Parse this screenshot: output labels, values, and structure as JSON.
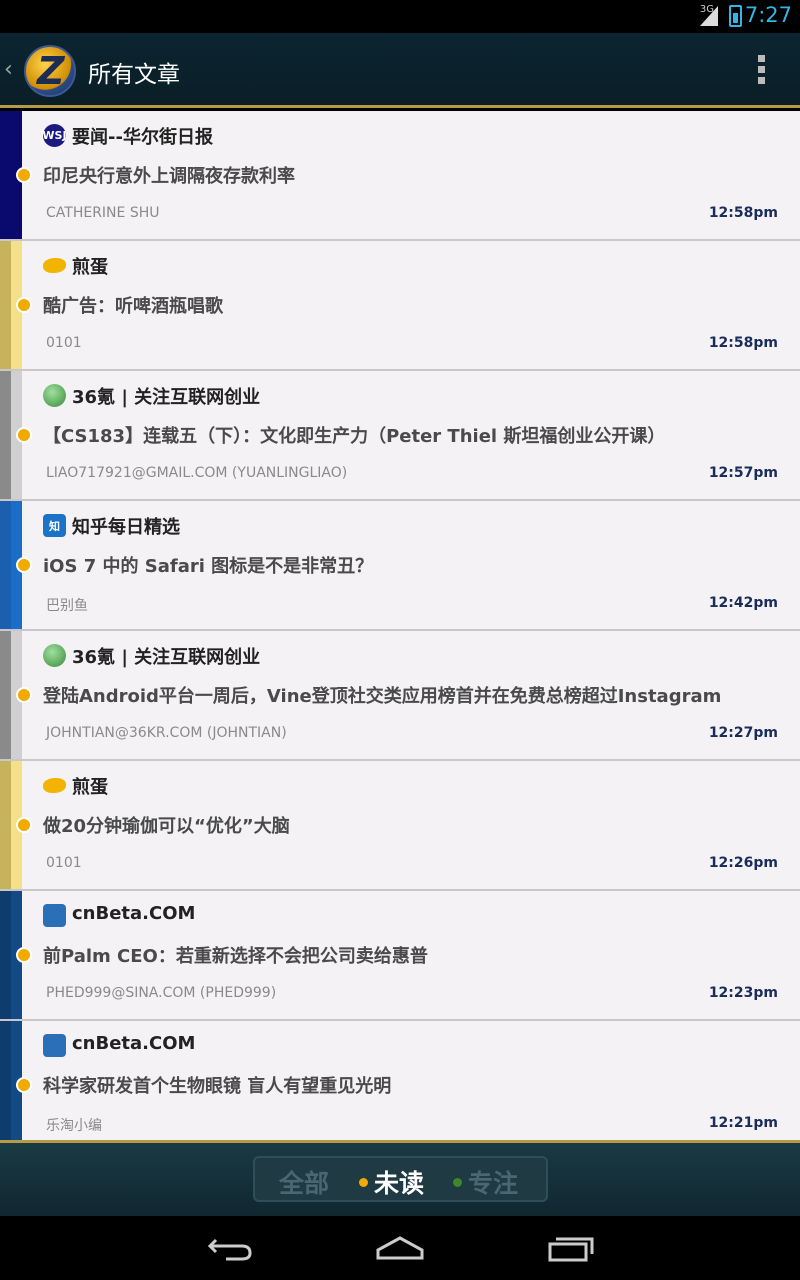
{
  "status_bar": {
    "network": "3G",
    "time": "7:27"
  },
  "action_bar": {
    "title": "所有文章"
  },
  "articles": [
    {
      "source": "要闻--华尔街日报",
      "source_icon": "WSJ",
      "title": "印尼央行意外上调隔夜存款利率",
      "author": "CATHERINE SHU",
      "time": "12:58pm",
      "color_dark": "#0a0a6e",
      "color_light": "#0a0a6e",
      "icon_bg": "#1a1a80"
    },
    {
      "source": "煎蛋",
      "source_icon": "",
      "title": "酷广告：听啤酒瓶唱歌",
      "author": "0101",
      "time": "12:58pm",
      "color_dark": "#c6b45c",
      "color_light": "#f5e08a",
      "icon_bg": "#f2b400"
    },
    {
      "source": "36氪 | 关注互联网创业",
      "source_icon": "",
      "title": "【CS183】连载五（下）：文化即生产力（Peter Thiel 斯坦福创业公开课）",
      "author": "LIAO717921@GMAIL.COM (YUANLINGLIAO)",
      "time": "12:57pm",
      "color_dark": "#8a8a8a",
      "color_light": "#d0d0d0",
      "icon_bg": "#4aa04a"
    },
    {
      "source": "知乎每日精选",
      "source_icon": "知",
      "title": "iOS 7 中的 Safari 图标是不是非常丑？",
      "author": "巴别鱼",
      "time": "12:42pm",
      "color_dark": "#1a5fb0",
      "color_light": "#1a6ec8",
      "icon_bg": "#1a73c8"
    },
    {
      "source": "36氪 | 关注互联网创业",
      "source_icon": "",
      "title": "登陆Android平台一周后，Vine登顶社交类应用榜首并在免费总榜超过Instagram",
      "author": "JOHNTIAN@36KR.COM (JOHNTIAN)",
      "time": "12:27pm",
      "color_dark": "#8a8a8a",
      "color_light": "#d0d0d0",
      "icon_bg": "#4aa04a"
    },
    {
      "source": "煎蛋",
      "source_icon": "",
      "title": "做20分钟瑜伽可以“优化”大脑",
      "author": "0101",
      "time": "12:26pm",
      "color_dark": "#c6b45c",
      "color_light": "#f5e08a",
      "icon_bg": "#f2b400"
    },
    {
      "source": "cnBeta.COM",
      "source_icon": "",
      "title": "前Palm CEO：若重新选择不会把公司卖给惠普",
      "author": "PHED999@SINA.COM (PHED999)",
      "time": "12:23pm",
      "color_dark": "#0f3c6e",
      "color_light": "#124a86",
      "icon_bg": "#2a6fb8"
    },
    {
      "source": "cnBeta.COM",
      "source_icon": "",
      "title": "科学家研发首个生物眼镜 盲人有望重见光明",
      "author": "乐淘小编",
      "time": "12:21pm",
      "color_dark": "#0f3c6e",
      "color_light": "#124a86",
      "icon_bg": "#2a6fb8"
    }
  ],
  "filter_bar": {
    "all_label": "全部",
    "unread_label": "未读",
    "starred_label": "专注",
    "active": "未读",
    "unread_dot_color": "#f2a900",
    "starred_dot_color": "#3a8a2a"
  }
}
